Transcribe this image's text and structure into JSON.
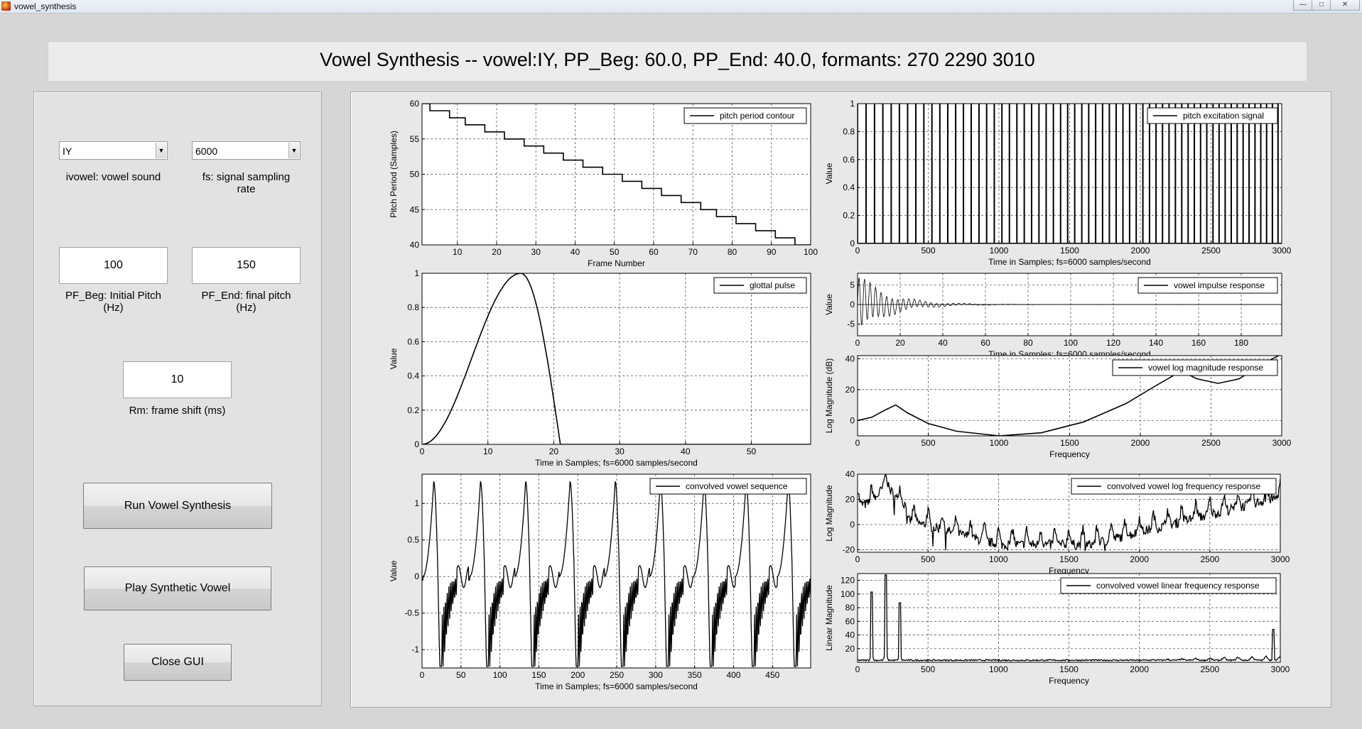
{
  "window": {
    "title": "vowel_synthesis"
  },
  "header": {
    "title": "Vowel Synthesis -- vowel:IY, PP_Beg: 60.0, PP_End: 40.0, formants: 270 2290 3010"
  },
  "controls": {
    "vowel_select": {
      "value": "IY",
      "label": "ivowel: vowel sound"
    },
    "fs_select": {
      "value": "6000",
      "label": "fs: signal sampling rate"
    },
    "pf_beg": {
      "value": "100",
      "label": "PF_Beg: Initial Pitch (Hz)"
    },
    "pf_end": {
      "value": "150",
      "label": "PF_End: final pitch (Hz)"
    },
    "rm": {
      "value": "10",
      "label": "Rm: frame shift (ms)"
    },
    "run_button": "Run Vowel Synthesis",
    "play_button": "Play Synthetic Vowel",
    "close_button": "Close GUI"
  },
  "chart_data": [
    {
      "id": "pitch-contour",
      "type": "line",
      "xlabel": "Frame Number",
      "ylabel": "Pitch Period (Samples)",
      "legend": "pitch period contour",
      "legend_position": "top-right",
      "grid": true,
      "xlim": [
        1,
        100
      ],
      "ylim": [
        40,
        60
      ],
      "xticks": [
        10,
        20,
        30,
        40,
        50,
        60,
        70,
        80,
        90,
        100
      ],
      "yticks": [
        40,
        45,
        50,
        55,
        60
      ],
      "steps": [
        [
          1,
          60
        ],
        [
          3,
          59
        ],
        [
          8,
          58
        ],
        [
          12,
          57
        ],
        [
          17,
          56
        ],
        [
          22,
          55
        ],
        [
          27,
          54
        ],
        [
          32,
          53
        ],
        [
          37,
          52
        ],
        [
          42,
          51
        ],
        [
          47,
          50
        ],
        [
          52,
          49
        ],
        [
          57,
          48
        ],
        [
          62,
          47
        ],
        [
          67,
          46
        ],
        [
          72,
          45
        ],
        [
          76,
          44
        ],
        [
          81,
          43
        ],
        [
          86,
          42
        ],
        [
          91,
          41
        ],
        [
          96,
          40
        ],
        [
          100,
          40
        ]
      ]
    },
    {
      "id": "pitch-excitation",
      "type": "line",
      "xlabel": "Time in Samples; fs=6000 samples/second",
      "ylabel": "Value",
      "legend": "pitch excitation signal",
      "legend_position": "top-right",
      "grid": true,
      "xlim": [
        0,
        3000
      ],
      "ylim": [
        0,
        1
      ],
      "xticks": [
        0,
        500,
        1000,
        1500,
        2000,
        2500,
        3000
      ],
      "yticks": [
        0,
        0.2,
        0.4,
        0.6,
        0.8,
        1
      ],
      "description_values": {
        "pulse_height": 1,
        "pulse_spacing_start": 60,
        "pulse_spacing_end": 40
      }
    },
    {
      "id": "glottal-pulse",
      "type": "line",
      "xlabel": "Time in Samples; fs=6000 samples/second",
      "ylabel": "Value",
      "legend": "glottal pulse",
      "legend_position": "top-right",
      "grid": true,
      "xlim": [
        0,
        59
      ],
      "ylim": [
        0,
        1
      ],
      "xticks": [
        0,
        10,
        20,
        30,
        40,
        50
      ],
      "yticks": [
        0,
        0.2,
        0.4,
        0.6,
        0.8,
        1
      ],
      "params": {
        "rise_samples": 15,
        "fall_end": 21
      }
    },
    {
      "id": "impulse-response",
      "type": "line",
      "xlabel": "Time in Samples; fs=6000 samples/second",
      "ylabel": "Value",
      "legend": "vowel impulse response",
      "legend_position": "top-right",
      "grid": true,
      "xlim": [
        0,
        199
      ],
      "ylim": [
        -8,
        8
      ],
      "xticks": [
        0,
        20,
        40,
        60,
        80,
        100,
        120,
        140,
        160,
        180
      ],
      "yticks": [
        -5,
        0,
        5
      ]
    },
    {
      "id": "log-magnitude",
      "type": "line",
      "xlabel": "Frequency",
      "ylabel": "Log Magnitude (dB)",
      "legend": "vowel log magnitude response",
      "legend_position": "top-right",
      "grid": true,
      "xlim": [
        0,
        3000
      ],
      "ylim": [
        -10,
        42
      ],
      "xticks": [
        0,
        500,
        1000,
        1500,
        2000,
        2500,
        3000
      ],
      "yticks": [
        0,
        20,
        40
      ],
      "x": [
        0,
        100,
        200,
        270,
        350,
        500,
        700,
        1000,
        1300,
        1600,
        1900,
        2100,
        2290,
        2400,
        2550,
        2700,
        2850,
        3000
      ],
      "y": [
        0,
        2,
        7,
        10,
        5,
        -2,
        -7,
        -10,
        -8,
        -1,
        11,
        22,
        32,
        27,
        24,
        27,
        36,
        43
      ]
    },
    {
      "id": "conv-sequence",
      "type": "line",
      "xlabel": "Time in Samples; fs=6000 samples/second",
      "ylabel": "Value",
      "legend": "convolved vowel sequence",
      "legend_position": "top-right",
      "grid": true,
      "xlim": [
        0,
        499
      ],
      "ylim": [
        -1.25,
        1.4
      ],
      "xticks": [
        0,
        50,
        100,
        150,
        200,
        250,
        300,
        350,
        400,
        450
      ],
      "yticks": [
        -1,
        -0.5,
        0,
        0.5,
        1
      ],
      "peaks": [
        15,
        75,
        133,
        190,
        248,
        306,
        362,
        416,
        470
      ]
    },
    {
      "id": "log-freq-resp",
      "type": "line",
      "xlabel": "Frequency",
      "ylabel": "Log Magnitude",
      "legend": "convolved vowel log frequency response",
      "legend_position": "top-right",
      "grid": true,
      "xlim": [
        0,
        3000
      ],
      "ylim": [
        -22,
        40
      ],
      "xticks": [
        0,
        500,
        1000,
        1500,
        2000,
        2500,
        3000
      ],
      "yticks": [
        -20,
        0,
        20,
        40
      ]
    },
    {
      "id": "lin-freq-resp",
      "type": "line",
      "xlabel": "Frequency",
      "ylabel": "Linear Magnitude",
      "legend": "convolved vowel linear frequency response",
      "legend_position": "top-right",
      "grid": true,
      "xlim": [
        0,
        3000
      ],
      "ylim": [
        0,
        130
      ],
      "xticks": [
        0,
        500,
        1000,
        1500,
        2000,
        2500,
        3000
      ],
      "yticks": [
        20,
        40,
        60,
        80,
        100,
        120
      ],
      "peaks": [
        [
          100,
          103
        ],
        [
          200,
          128
        ],
        [
          300,
          87
        ],
        [
          2950,
          48
        ]
      ]
    }
  ]
}
